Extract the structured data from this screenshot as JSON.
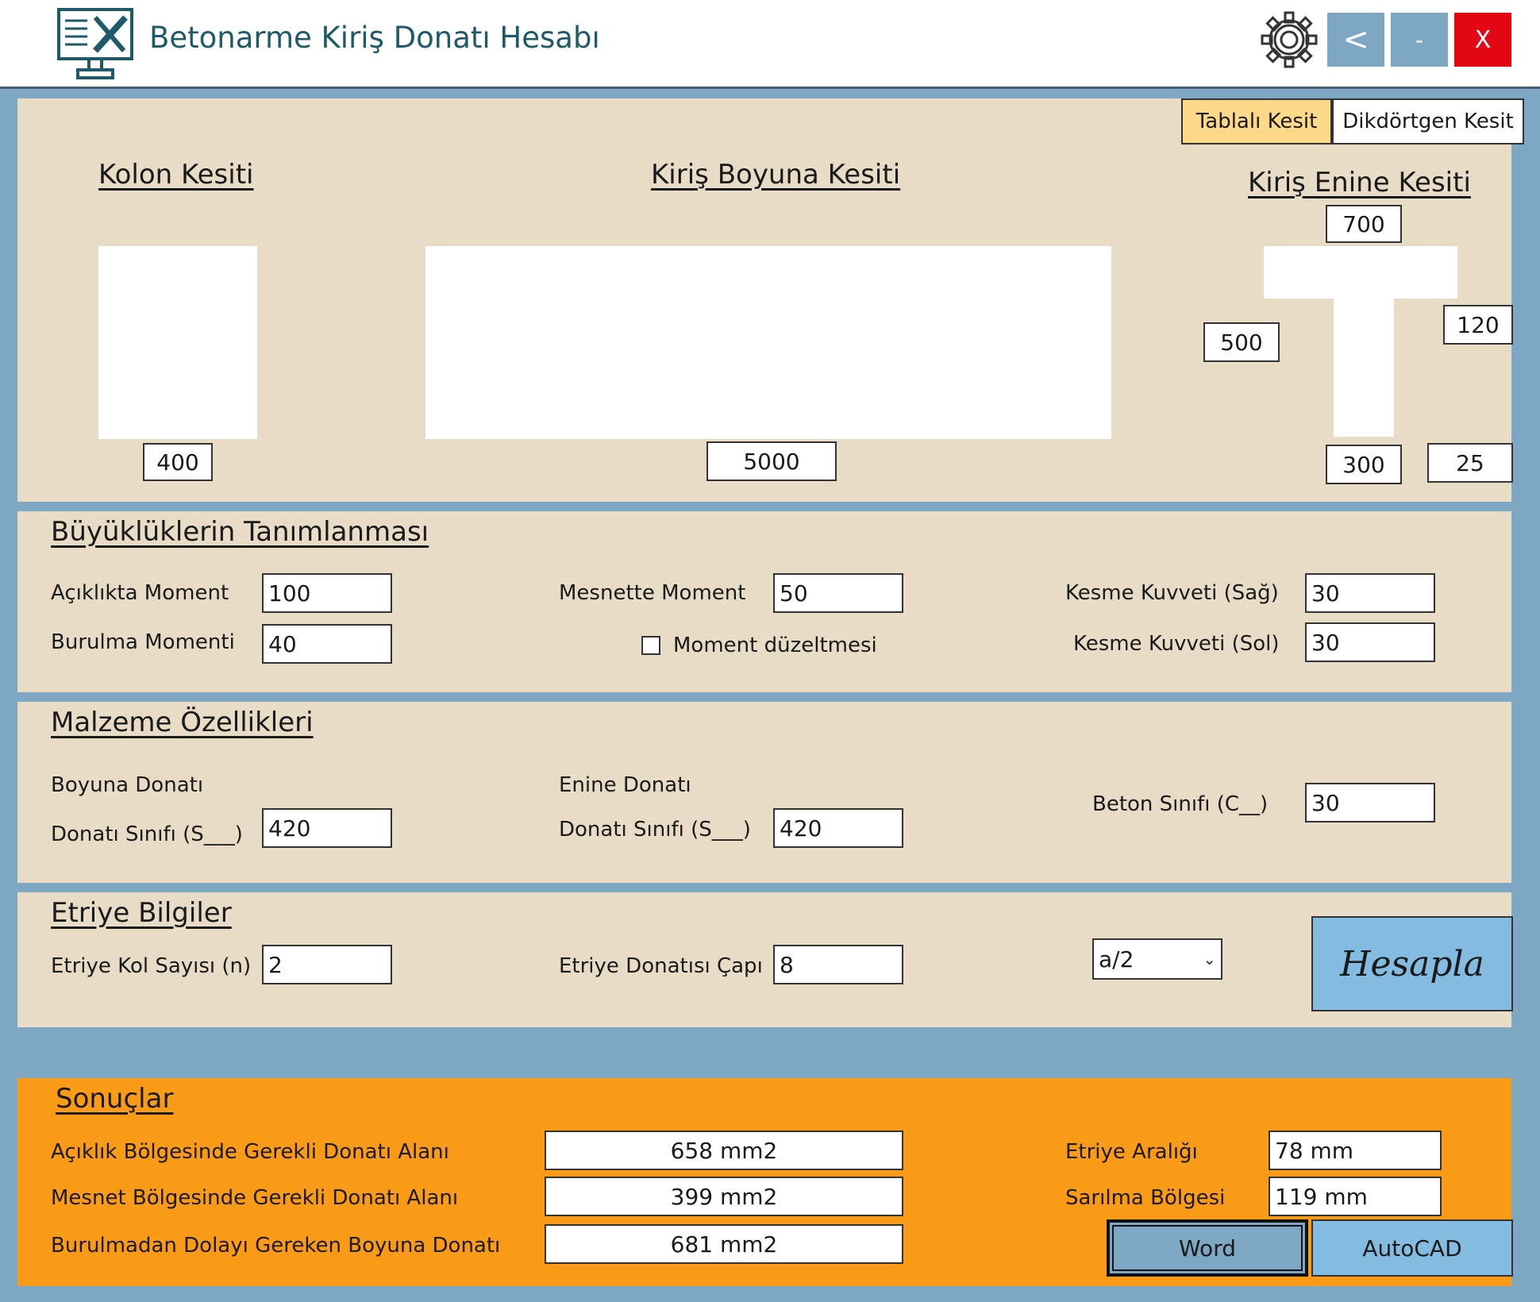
{
  "app": {
    "title": "Betonarme Kiriş Donatı Hesabı",
    "buttons": {
      "back": "<",
      "minimize": "-",
      "close": "X"
    }
  },
  "section_tabs": [
    "Tablalı Kesit",
    "Dikdörtgen Kesit"
  ],
  "sections": {
    "column": {
      "title": "Kolon Kesiti",
      "width": "400"
    },
    "beam_long": {
      "title": "Kiriş Boyuna Kesiti",
      "length": "5000"
    },
    "beam_cross": {
      "title": "Kiriş Enine Kesiti",
      "flange_width": "700",
      "height": "500",
      "flange_thickness": "120",
      "web_width": "300",
      "cover": "25"
    }
  },
  "loads": {
    "title": "Büyüklüklerin Tanımlanması",
    "span_moment": {
      "label": "Açıklıkta Moment",
      "value": "100"
    },
    "torsion_moment": {
      "label": "Burulma Momenti",
      "value": "40"
    },
    "support_moment": {
      "label": "Mesnette Moment",
      "value": "50"
    },
    "moment_correction": {
      "label": "Moment düzeltmesi",
      "checked": false
    },
    "shear_right": {
      "label": "Kesme Kuvveti (Sağ)",
      "value": "30"
    },
    "shear_left": {
      "label": "Kesme Kuvveti (Sol)",
      "value": "30"
    }
  },
  "material": {
    "title": "Malzeme Özellikleri",
    "long_rebar": {
      "heading": "Boyuna Donatı",
      "label": "Donatı Sınıfı (S___)",
      "value": "420"
    },
    "trans_rebar": {
      "heading": "Enine Donatı",
      "label": "Donatı Sınıfı (S___)",
      "value": "420"
    },
    "concrete": {
      "label": "Beton Sınıfı (C__)",
      "value": "30"
    }
  },
  "stirrup": {
    "title": "Etriye Bilgiler",
    "legs": {
      "label": "Etriye Kol Sayısı (n)",
      "value": "2"
    },
    "diameter": {
      "label": "Etriye Donatısı Çapı",
      "value": "8"
    },
    "select_value": "a/2",
    "calculate": "Hesapla"
  },
  "results": {
    "title": "Sonuçlar",
    "span_area": {
      "label": "Açıklık Bölgesinde Gerekli Donatı Alanı",
      "value": "658 mm2"
    },
    "support_area": {
      "label": "Mesnet Bölgesinde Gerekli Donatı Alanı",
      "value": "399 mm2"
    },
    "torsion_area": {
      "label": "Burulmadan Dolayı Gereken Boyuna Donatı",
      "value": "681 mm2"
    },
    "stirrup_spacing": {
      "label": "Etriye Aralığı",
      "value": "78 mm"
    },
    "confinement_zone": {
      "label": "Sarılma Bölgesi",
      "value": "119 mm"
    },
    "export": {
      "word": "Word",
      "autocad": "AutoCAD"
    }
  },
  "colors": {
    "background": "#7da7c3",
    "panel": "#e8dcc6",
    "results_panel": "#fa9b17",
    "close_button": "#e30613",
    "active_tab": "#ffd98a",
    "calc_button": "#84bbe0"
  }
}
